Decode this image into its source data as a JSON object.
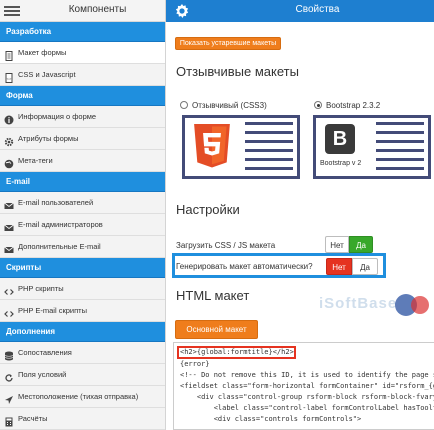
{
  "sidebar": {
    "title": "Компоненты",
    "sections": [
      {
        "title": "Разработка",
        "items": [
          {
            "label": "Макет формы",
            "icon": "document-icon",
            "active": true
          },
          {
            "label": "CSS и Javascript",
            "icon": "code-file-icon"
          }
        ]
      },
      {
        "title": "Форма",
        "items": [
          {
            "label": "Информация о форме",
            "icon": "info-icon"
          },
          {
            "label": "Атрибуты формы",
            "icon": "gear-icon"
          },
          {
            "label": "Мета-теги",
            "icon": "globe-icon"
          }
        ]
      },
      {
        "title": "E-mail",
        "items": [
          {
            "label": "E-mail пользователей",
            "icon": "envelope-icon"
          },
          {
            "label": "E-mail администраторов",
            "icon": "envelope-icon"
          },
          {
            "label": "Дополнительные E-mail",
            "icon": "envelope-icon"
          }
        ]
      },
      {
        "title": "Скрипты",
        "items": [
          {
            "label": "PHP скрипты",
            "icon": "code-icon"
          },
          {
            "label": "PHP E-mail скрипты",
            "icon": "code-icon"
          }
        ]
      },
      {
        "title": "Дополнения",
        "items": [
          {
            "label": "Сопоставления",
            "icon": "database-icon"
          },
          {
            "label": "Поля условий",
            "icon": "refresh-icon"
          },
          {
            "label": "Местоположение (тихая отправка)",
            "icon": "location-icon"
          },
          {
            "label": "Расчёты",
            "icon": "calculator-icon"
          }
        ]
      }
    ]
  },
  "topbar": {
    "title": "Свойства"
  },
  "main": {
    "show_layouts_button": "Показать устаревшие макеты",
    "responsive_heading": "Отзывчивые макеты",
    "option_css3": "Отзывчивый (CSS3)",
    "option_bootstrap": "Bootstrap 2.3.2",
    "bootstrap_card_caption": "Bootstrap v 2",
    "selected_layout": "Bootstrap 2.3.2",
    "settings_heading": "Настройки",
    "load_css_js_label": "Загрузить CSS / JS макета",
    "load_css_js_no": "Нет",
    "load_css_js_yes": "Да",
    "load_css_js_value": "Да",
    "auto_layout_label": "Генерировать макет автоматически?",
    "auto_layout_no": "Нет",
    "auto_layout_yes": "Да",
    "auto_layout_value": "Нет",
    "html_heading": "HTML макет",
    "main_layout_button": "Основной макет",
    "code_lines": [
      "<h2>{global:formtitle}</h2>",
      "{error}",
      "<!-- Do not remove this ID, it is used to identify the page so that the p",
      "<fieldset class=\"form-horizontal formContainer\" id=\"rsform_{global:",
      "    <div class=\"control-group rsform-block rsform-block-fvary\">",
      "        <label class=\"control-label formControlLabel hasTooltip",
      "        <div class=\"controls formControls\">"
    ],
    "watermark": "iSoftBase"
  },
  "colors": {
    "sidebar_section": "#1f8fde",
    "topbar": "#1e7fd0",
    "orange": "#ef7d1c",
    "toggle_yes_active": "#38a82b",
    "toggle_no_active": "#e53320",
    "highlight": "#1f8fde",
    "code_highlight": "#e53320"
  }
}
